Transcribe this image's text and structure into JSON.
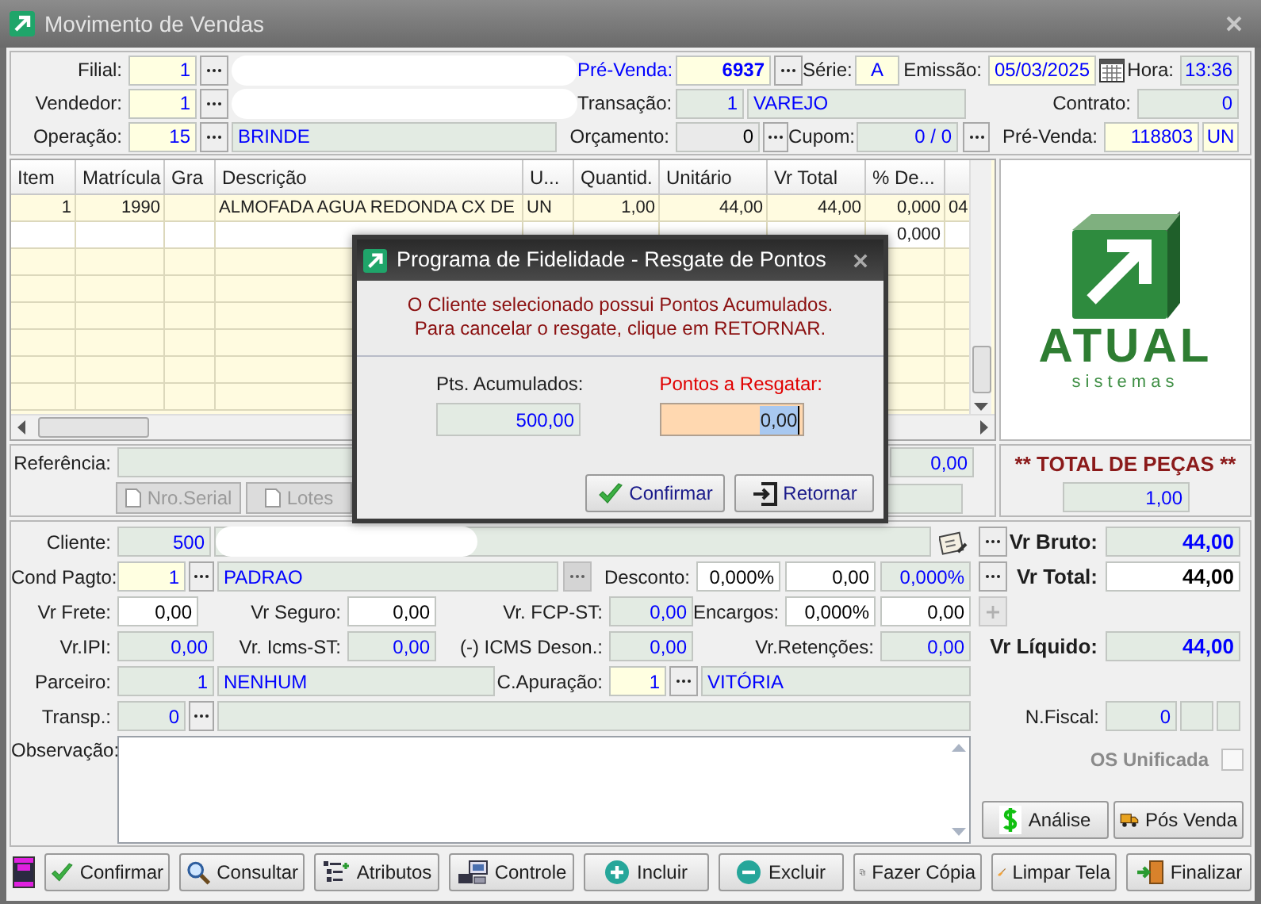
{
  "window": {
    "title": "Movimento de Vendas"
  },
  "header": {
    "filial": {
      "label": "Filial:",
      "value": "1"
    },
    "vendedor": {
      "label": "Vendedor:",
      "value": "1"
    },
    "operacao": {
      "label": "Operação:",
      "value": "15",
      "name": "BRINDE"
    },
    "pre_venda": {
      "label": "Pré-Venda:",
      "value": "6937"
    },
    "serie": {
      "label": "Série:",
      "value": "A"
    },
    "emissao": {
      "label": "Emissão:",
      "value": "05/03/2025"
    },
    "hora": {
      "label": "Hora:",
      "value": "13:36"
    },
    "transacao": {
      "label": "Transação:",
      "value": "1",
      "name": "VAREJO"
    },
    "contrato": {
      "label": "Contrato:",
      "value": "0"
    },
    "orcamento": {
      "label": "Orçamento:",
      "value": "0"
    },
    "cupom": {
      "label": "Cupom:",
      "value": "0 / 0"
    },
    "pre_venda_numero": {
      "label": "Pré-Venda:",
      "value": "118803",
      "unit": "UN"
    }
  },
  "items_grid": {
    "columns": [
      "Item",
      "Matrícula",
      "Gra",
      "Descrição",
      "U...",
      "Quantid.",
      "Unitário",
      "Vr Total",
      "% De..."
    ],
    "rows": [
      {
        "selected": false,
        "cells": {
          "item": "1",
          "matricula": "1990",
          "descricao": "ALMOFADA AGUA REDONDA CX DE",
          "unidade": "UN",
          "quantidade": "1,00",
          "unitario": "44,00",
          "vr_total": "44,00",
          "desconto": "0,000",
          "column_10": "04"
        }
      },
      {
        "selected": true,
        "cells": {
          "desconto": "0,000"
        }
      }
    ]
  },
  "logo": {
    "name": "ATUAL",
    "tagline": "sistemas"
  },
  "reference": {
    "label": "Referência:",
    "amount": "0,00",
    "buttons": [
      {
        "label": "Nro.Serial",
        "disabled": true
      },
      {
        "label": "Lotes",
        "disabled": true
      }
    ]
  },
  "total_pecas": {
    "title": "** TOTAL DE PEÇAS **",
    "value": "1,00"
  },
  "form": {
    "cliente": {
      "label": "Cliente:",
      "value": "500"
    },
    "cond_pagto": {
      "label": "Cond Pagto:",
      "value": "1",
      "name": "PADRAO",
      "lookup_disabled": true
    },
    "desconto": {
      "label": "Desconto:",
      "percent": "0,000%",
      "value": "0,00",
      "percent_total": "0,000%"
    },
    "vr_frete": {
      "label": "Vr Frete:",
      "value": "0,00"
    },
    "vr_seguro": {
      "label": "Vr Seguro:",
      "value": "0,00"
    },
    "vr_fcp_st": {
      "label": "Vr. FCP-ST:",
      "value": "0,00"
    },
    "encargos": {
      "label": "Encargos:",
      "percent": "0,000%",
      "value": "0,00",
      "add_disabled": true
    },
    "vr_ipi": {
      "label": "Vr.IPI:",
      "value": "0,00"
    },
    "vr_icms_st": {
      "label": "Vr. Icms-ST:",
      "value": "0,00"
    },
    "icms_deson": {
      "label": "(-) ICMS Deson.:",
      "value": "0,00"
    },
    "vr_retencoes": {
      "label": "Vr.Retenções:",
      "value": "0,00"
    },
    "parceiro": {
      "label": "Parceiro:",
      "value": "1",
      "name": "NENHUM"
    },
    "c_apuracao": {
      "label": "C.Apuração:",
      "value": "1",
      "name": "VITÓRIA"
    },
    "transp": {
      "label": "Transp.:",
      "value": "0"
    },
    "observacao": {
      "label": "Observação:"
    },
    "vr_bruto": {
      "label": "Vr Bruto:",
      "value": "44,00"
    },
    "vr_total": {
      "label": "Vr Total:",
      "value": "44,00"
    },
    "vr_liquido": {
      "label": "Vr Líquido:",
      "value": "44,00"
    },
    "n_fiscal": {
      "label": "N.Fiscal:",
      "value": "0"
    },
    "os_unificada": {
      "label": "OS Unificada",
      "checked": false,
      "disabled": true
    }
  },
  "side_buttons": [
    {
      "label": "Análise",
      "kind": "dollar"
    },
    {
      "label": "Pós Venda",
      "kind": "truck"
    }
  ],
  "toolbar": [
    {
      "label": "Confirmar",
      "kind": "check"
    },
    {
      "label": "Consultar",
      "kind": "search"
    },
    {
      "label": "Atributos",
      "kind": "list"
    },
    {
      "label": "Controle",
      "kind": "computer"
    },
    {
      "label": "Incluir",
      "kind": "plus"
    },
    {
      "label": "Excluir",
      "kind": "minus"
    },
    {
      "label": "Fazer Cópia",
      "kind": "copy"
    },
    {
      "label": "Limpar Tela",
      "kind": "broom"
    },
    {
      "label": "Finalizar",
      "kind": "exit"
    }
  ],
  "dialog": {
    "title": "Programa de Fidelidade - Resgate de Pontos",
    "message": [
      "O Cliente selecionado possui Pontos Acumulados.",
      "Para cancelar o resgate, clique em RETORNAR."
    ],
    "accumulated": {
      "label": "Pts. Acumulados:",
      "value": "500,00"
    },
    "redeem": {
      "label": "Pontos a Resgatar:",
      "value": "0,00"
    },
    "buttons": [
      {
        "label": "Confirmar",
        "kind": "check"
      },
      {
        "label": "Retornar",
        "kind": "return"
      }
    ]
  }
}
